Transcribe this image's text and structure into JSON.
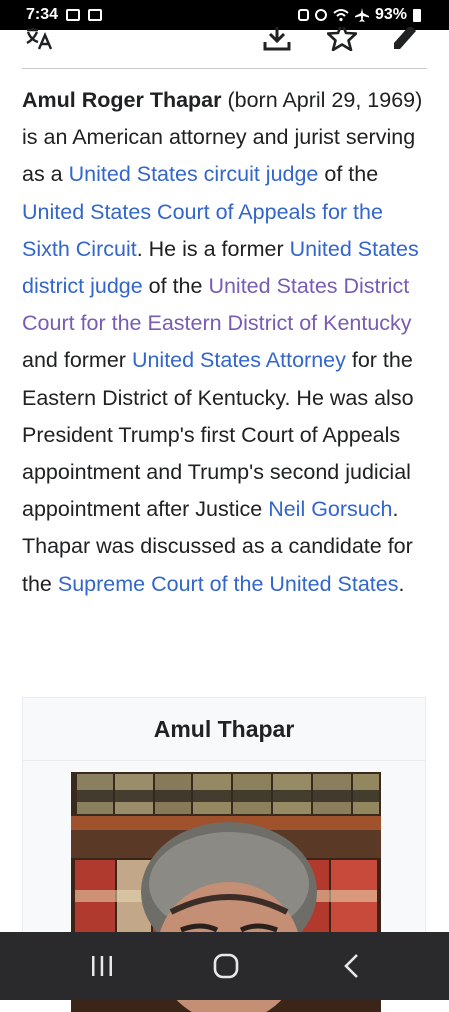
{
  "status_bar": {
    "time": "7:34",
    "battery": "93%"
  },
  "toolbar": {
    "language_icon": "translate-icon",
    "download_icon": "download-icon",
    "watch_icon": "star-icon",
    "edit_icon": "pencil-icon"
  },
  "article": {
    "subject_name": "Amul Roger Thapar",
    "segments": {
      "s1": " (born April 29, 1969) is an American attorney and jurist serving as a ",
      "l1": "United States circuit judge",
      "s2": " of the ",
      "l2": "United States Court of Appeals for the Sixth Circuit",
      "s3": ". He is a former ",
      "l3": "United States district judge",
      "s4": " of the ",
      "l4": "United States District Court for the Eastern District of Kentucky",
      "s5": " and former ",
      "l5": "United States Attorney",
      "s6": " for the Eastern District of Kentucky. He was also President Trump's first Court of Appeals appointment and Trump's second judicial appointment after Justice ",
      "l6": "Neil Gorsuch",
      "s7": ". Thapar was discussed as a candidate for the ",
      "l7": "Supreme Court of the United States",
      "s8": "."
    }
  },
  "infobox": {
    "title": "Amul Thapar"
  },
  "colors": {
    "link": "#3366cc",
    "visited_link": "#795cb2",
    "text": "#202122"
  },
  "nav": {
    "recents_icon": "recents-icon",
    "home_icon": "home-icon",
    "back_icon": "back-icon"
  }
}
